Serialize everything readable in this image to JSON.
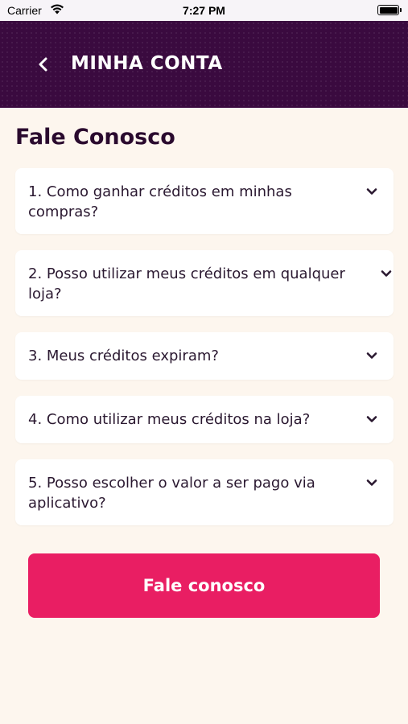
{
  "status_bar": {
    "carrier": "Carrier",
    "time": "7:27 PM"
  },
  "header": {
    "title": "MINHA CONTA",
    "back_icon": "chevron-left-icon",
    "background_color": "#3a0a3f"
  },
  "page_title": "Fale Conosco",
  "faq": [
    {
      "question": "1. Como ganhar créditos em minhas compras?",
      "icon": "chevron-down-icon"
    },
    {
      "question": "2. Posso utilizar meus créditos em qualquer loja?",
      "icon": "chevron-down-icon"
    },
    {
      "question": "3. Meus créditos expiram?",
      "icon": "chevron-down-icon"
    },
    {
      "question": "4. Como utilizar meus créditos na loja?",
      "icon": "chevron-down-icon"
    },
    {
      "question": "5. Posso escolher o valor a ser pago via aplicativo?",
      "icon": "chevron-down-icon"
    }
  ],
  "contact_button": {
    "label": "Fale conosco",
    "color": "#e91e63"
  },
  "colors": {
    "page_background": "#fdf6ee",
    "title_text": "#2a0a2e"
  }
}
